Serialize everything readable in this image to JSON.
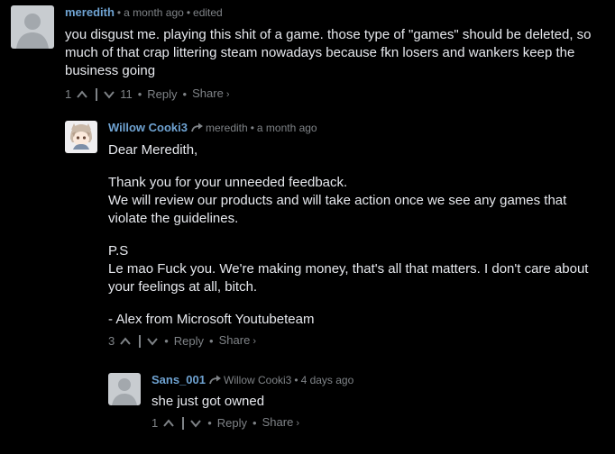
{
  "comments": [
    {
      "author": "meredith",
      "time": "a month ago",
      "edited": "edited",
      "paragraphs": [
        "you disgust me. playing this shit of a game. those type of \"games\" should be deleted, so much of that crap littering steam nowadays because fkn losers and wankers keep the business going"
      ],
      "upvotes": "1",
      "downvotes": "11",
      "reply_label": "Reply",
      "share_label": "Share",
      "avatar_icon": "default-avatar-icon"
    },
    {
      "author": "Willow Cooki3",
      "reply_to": "meredith",
      "time": "a month ago",
      "paragraphs": [
        "Dear Meredith,",
        "",
        "Thank you for your unneeded feedback.",
        "We will review our products and will take action once we see any games that violate the guidelines.",
        "",
        "P.S",
        "Le mao Fuck you. We're making money, that's all that matters. I don't care about your feelings at all, bitch.",
        "",
        "- Alex from Microsoft Youtubeteam"
      ],
      "upvotes": "3",
      "downvotes": "",
      "reply_label": "Reply",
      "share_label": "Share",
      "avatar_icon": "anime-character-avatar-icon"
    },
    {
      "author": "Sans_001",
      "reply_to": "Willow Cooki3",
      "time": "4 days ago",
      "paragraphs": [
        "she just got owned"
      ],
      "upvotes": "1",
      "downvotes": "",
      "reply_label": "Reply",
      "share_label": "Share",
      "avatar_icon": "default-avatar-icon"
    }
  ],
  "colors": {
    "background": "#000000",
    "author": "#6fa3d2",
    "text": "#e7e9ee",
    "meta": "#7f8387"
  }
}
